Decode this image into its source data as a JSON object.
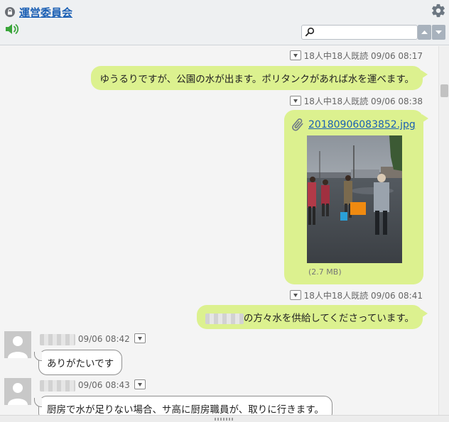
{
  "header": {
    "room_title": "運営委員会",
    "search": {
      "value": "",
      "placeholder": ""
    }
  },
  "messages": [
    {
      "type": "outgoing",
      "meta": "18人中18人既読 09/06 08:17",
      "text": "ゆうるりですが、公園の水が出ます。ポリタンクがあれば水を運べます。"
    },
    {
      "type": "outgoing-attachment",
      "meta": "18人中18人既読 09/06 08:38",
      "filename": "20180906083852.jpg",
      "size": "(2.7 MB)"
    },
    {
      "type": "outgoing",
      "meta": "18人中18人既読 09/06 08:41",
      "text": "の方々水を供給してくださっています。"
    },
    {
      "type": "incoming",
      "meta": "09/06 08:42",
      "text": "ありがたいです"
    },
    {
      "type": "incoming",
      "meta": "09/06 08:43",
      "text": "厨房で水が足りない場合、サ高に厨房職員が、取りに行きます。"
    }
  ],
  "colors": {
    "accent": "#1a5fb4",
    "bubble_out": "#dcf18f",
    "speaker": "#3aa53a"
  }
}
